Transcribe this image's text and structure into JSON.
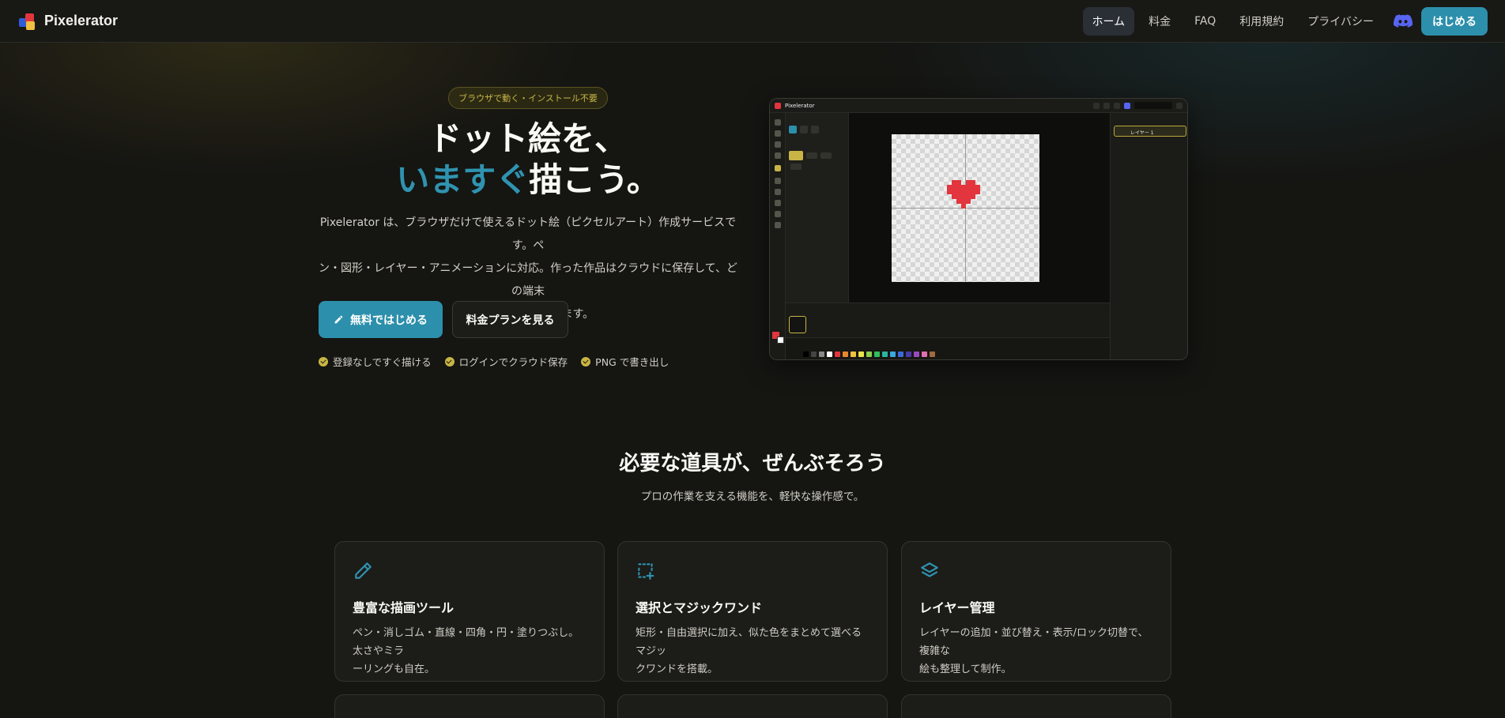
{
  "nav": {
    "brand": "Pixelerator",
    "links": [
      "ホーム",
      "料金",
      "FAQ",
      "利用規約",
      "プライバシー"
    ],
    "start": "はじめる"
  },
  "hero": {
    "badge": "ブラウザで動く・インストール不要",
    "title_line1": "ドット絵を、",
    "title_accent": "いますぐ",
    "title_rest": "描こう。",
    "desc_line1": "Pixelerator は、ブラウザだけで使えるドット絵（ピクセルアート）作成サービスです。ペ",
    "desc_line2": "ン・図形・レイヤー・アニメーションに対応。作った作品はクラウドに保存して、どの端末",
    "desc_line3": "からでも続きを描けます。",
    "cta_primary": "無料ではじめる",
    "cta_secondary": "料金プランを見る",
    "checks": [
      "登録なしですぐ描ける",
      "ログインでクラウド保存",
      "PNG で書き出し"
    ]
  },
  "preview": {
    "app_name": "Pixelerator",
    "layer_name": "レイヤー 1",
    "palette": [
      "#000000",
      "#444444",
      "#888888",
      "#ffffff",
      "#e2353d",
      "#e8862e",
      "#f0c040",
      "#e8e44a",
      "#8ad04a",
      "#2fbf5a",
      "#2bb5a0",
      "#3aa8e0",
      "#3a6ad8",
      "#4a3aa8",
      "#9a4ac0",
      "#e070b0",
      "#a06a40"
    ]
  },
  "features": {
    "title": "必要な道具が、ぜんぶそろう",
    "subtitle": "プロの作業を支える機能を、軽快な操作感で。",
    "cards": [
      {
        "title": "豊富な描画ツール",
        "text_line1": "ペン・消しゴム・直線・四角・円・塗りつぶし。太さやミラ",
        "text_line2": "ーリングも自在。",
        "icon": "pencil-icon"
      },
      {
        "title": "選択とマジックワンド",
        "text_line1": "矩形・自由選択に加え、似た色をまとめて選べるマジッ",
        "text_line2": "クワンドを搭載。",
        "icon": "selection-add-icon"
      },
      {
        "title": "レイヤー管理",
        "text_line1": "レイヤーの追加・並び替え・表示/ロック切替で、複雑な",
        "text_line2": "絵も整理して制作。",
        "icon": "layers-icon"
      }
    ]
  },
  "colors": {
    "accent": "#2c8fab",
    "gold": "#c8b545"
  }
}
